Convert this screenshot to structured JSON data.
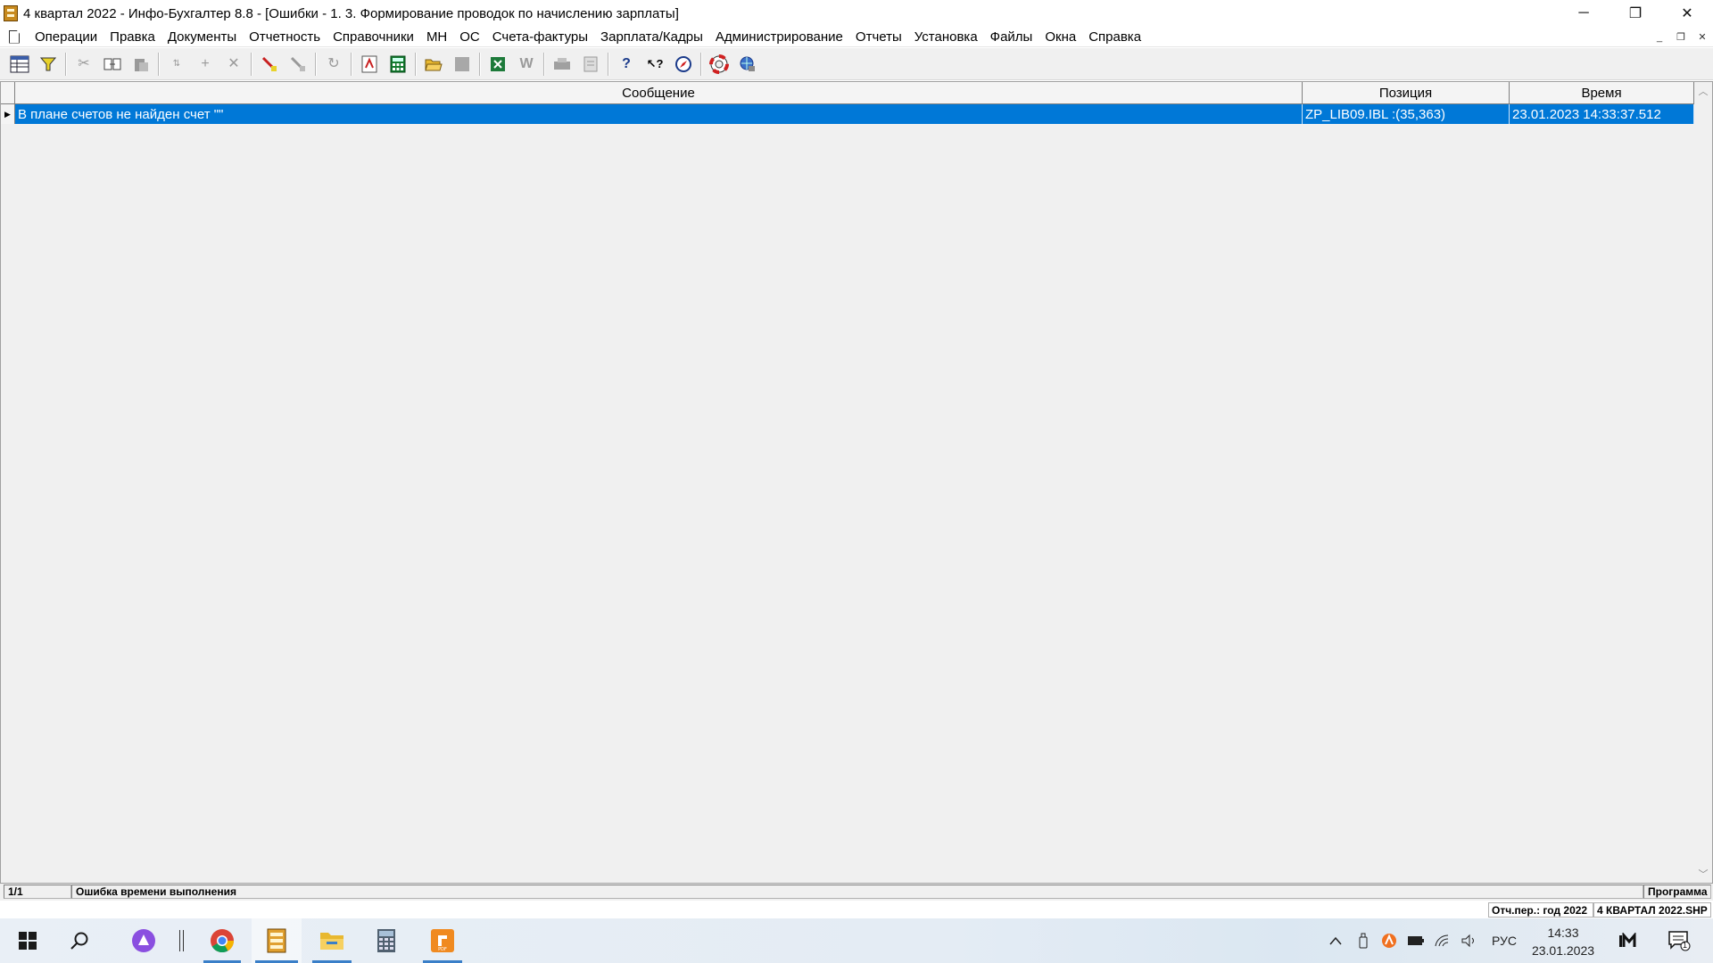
{
  "window": {
    "title": "4 квартал 2022 - Инфо-Бухгалтер 8.8 - [Ошибки - 1. 3. Формирование проводок по начислению зарплаты]",
    "minimize": "─",
    "maximize": "❐",
    "close": "✕"
  },
  "menu": {
    "items": [
      "Операции",
      "Правка",
      "Документы",
      "Отчетность",
      "Справочники",
      "МН",
      "ОС",
      "Счета-фактуры",
      "Зарплата/Кадры",
      "Администрирование",
      "Отчеты",
      "Установка",
      "Файлы",
      "Окна",
      "Справка"
    ],
    "mdi_minimize": "_",
    "mdi_restore": "❐",
    "mdi_close": "✕"
  },
  "toolbar": {
    "icons": [
      "grid-icon",
      "filter-icon",
      "cut-icon",
      "copy-icon",
      "paste-icon",
      "sort-icon",
      "add-icon",
      "delete-icon",
      "mark-icon",
      "unmark-icon",
      "refresh-icon",
      "pdf-icon",
      "calculator-icon",
      "open-folder-icon",
      "save-icon",
      "excel-icon",
      "word-icon",
      "print-icon",
      "preview-icon",
      "help-icon",
      "context-help-icon",
      "compass-icon",
      "lifebuoy-icon",
      "web-icon"
    ]
  },
  "grid": {
    "columns": [
      "Сообщение",
      "Позиция",
      "Время"
    ],
    "rows": [
      {
        "message": "В плане счетов не найден счет \"\"",
        "position": "ZP_LIB09.IBL :(35,363)",
        "time": "23.01.2023 14:33:37.512"
      }
    ]
  },
  "status": {
    "record": "1/1",
    "message": "Ошибка времени выполнения",
    "right": "Программа",
    "period": "Отч.пер.: год 2022",
    "file": "4 КВАРТАЛ 2022.SHP"
  },
  "taskbar": {
    "apps": [
      "windows-start-icon",
      "search-icon",
      "alice-icon",
      "chrome-icon",
      "info-buhgalter-icon",
      "file-explorer-icon",
      "calculator-icon",
      "pdf-app-icon"
    ],
    "language": "РУС",
    "time": "14:33",
    "date": "23.01.2023",
    "notifications": "1"
  },
  "colors": {
    "selection": "#0078d7",
    "taskbar_accent": "#3a7fc8"
  }
}
